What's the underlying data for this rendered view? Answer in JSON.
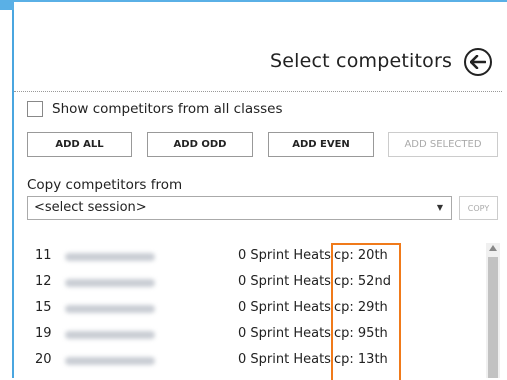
{
  "header": {
    "title": "Select competitors",
    "back_icon": "arrow-left-icon"
  },
  "options": {
    "show_all_label": "Show competitors from all classes",
    "show_all_checked": false
  },
  "buttons": {
    "add_all": "ADD ALL",
    "add_odd": "ADD ODD",
    "add_even": "ADD EVEN",
    "add_selected": "ADD SELECTED"
  },
  "copy": {
    "label": "Copy competitors from",
    "session_value": "<select session>",
    "copy_button": "COPY"
  },
  "competitors": [
    {
      "number": "11",
      "heats": "0 Sprint Heats",
      "cp": "cp: 20th"
    },
    {
      "number": "12",
      "heats": "0 Sprint Heats",
      "cp": "cp: 52nd"
    },
    {
      "number": "15",
      "heats": "0 Sprint Heats",
      "cp": "cp: 29th"
    },
    {
      "number": "19",
      "heats": "0 Sprint Heats",
      "cp": "cp: 95th"
    },
    {
      "number": "20",
      "heats": "0 Sprint Heats",
      "cp": "cp: 13th"
    }
  ],
  "colors": {
    "accent": "#4aa6e0",
    "highlight": "#f07a1a"
  }
}
